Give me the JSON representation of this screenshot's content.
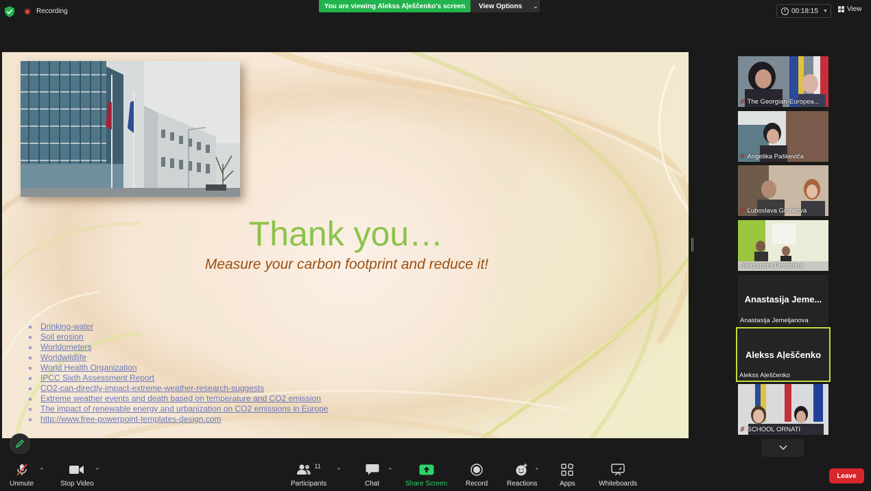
{
  "topbar": {
    "recording_label": "Recording",
    "viewing_banner": "You are viewing Alekss Aļeščenko's screen",
    "view_options_label": "View Options",
    "timer": "00:18:15",
    "view_label": "View"
  },
  "slide": {
    "title": "Thank you…",
    "subtitle": "Measure your carbon footprint and reduce it!",
    "references": [
      "Drinking-water",
      "Soil erosion",
      "Worldometers",
      "Worldwildlife",
      "World Health Organization",
      "IPCC Sixth Assessment Report",
      "CO2-can-directly-impact-extreme-weather-research-suggests",
      "Extreme weather events and death based on temperature and CO2 emission",
      "The impact of renewable energy and urbanization on CO2 emissions in Europe",
      "http://www.free-powerpoint-templates-design.com"
    ]
  },
  "participants": [
    {
      "name": "The Georgian-Europea...",
      "muted": true
    },
    {
      "name": "Angelika Paškeviča",
      "muted": true
    },
    {
      "name": "Ľuboslava Grufiková",
      "muted": true
    },
    {
      "name": "Aleksandra Pomitkina",
      "muted": false
    },
    {
      "name": "Anastasija Jemeljanova",
      "big_name": "Anastasija Jeme...",
      "muted": false
    },
    {
      "name": "Alekss Aļeščenko",
      "big_name": "Alekss Aļeščenko",
      "muted": false,
      "active": true
    },
    {
      "name": "SCHOOL ORNATI",
      "muted": true
    }
  ],
  "toolbar": {
    "unmute": "Unmute",
    "stop_video": "Stop Video",
    "participants": "Participants",
    "participants_count": "11",
    "chat": "Chat",
    "share_screen": "Share Screen",
    "record": "Record",
    "reactions": "Reactions",
    "apps": "Apps",
    "whiteboards": "Whiteboards",
    "leave": "Leave"
  },
  "colors": {
    "banner_green": "#21b34d",
    "leave_red": "#d7262c",
    "title_green": "#8cc24c",
    "subtitle_brown": "#9a4f12",
    "active_border": "#c7d83f"
  }
}
